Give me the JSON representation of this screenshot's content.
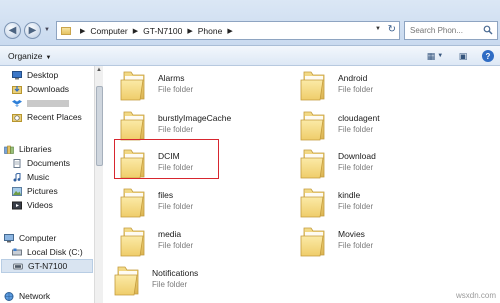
{
  "address": {
    "crumbs": [
      "Computer",
      "GT-N7100",
      "Phone"
    ]
  },
  "search": {
    "placeholder": "Search Phon..."
  },
  "toolbar": {
    "organize_label": "Organize"
  },
  "sidebar": {
    "items": [
      {
        "label": "Desktop",
        "icon": "desktop-icon"
      },
      {
        "label": "Downloads",
        "icon": "downloads-icon"
      },
      {
        "label": "",
        "icon": "dropbox-icon"
      },
      {
        "label": "Recent Places",
        "icon": "recent-places-icon"
      },
      {
        "label": "Libraries",
        "icon": "libraries-icon"
      },
      {
        "label": "Documents",
        "icon": "documents-icon"
      },
      {
        "label": "Music",
        "icon": "music-icon"
      },
      {
        "label": "Pictures",
        "icon": "pictures-icon"
      },
      {
        "label": "Videos",
        "icon": "videos-icon"
      },
      {
        "label": "Computer",
        "icon": "computer-icon"
      },
      {
        "label": "Local Disk (C:)",
        "icon": "local-disk-icon"
      },
      {
        "label": "GT-N7100",
        "icon": "phone-device-icon"
      },
      {
        "label": "Network",
        "icon": "network-icon"
      }
    ]
  },
  "folders": [
    {
      "name": "Alarms",
      "type": "File folder"
    },
    {
      "name": "Android",
      "type": "File folder"
    },
    {
      "name": "burstlyImageCache",
      "type": "File folder"
    },
    {
      "name": "cloudagent",
      "type": "File folder"
    },
    {
      "name": "DCIM",
      "type": "File folder"
    },
    {
      "name": "Download",
      "type": "File folder"
    },
    {
      "name": "files",
      "type": "File folder"
    },
    {
      "name": "kindle",
      "type": "File folder"
    },
    {
      "name": "media",
      "type": "File folder"
    },
    {
      "name": "Movies",
      "type": "File folder"
    },
    {
      "name": "Notifications",
      "type": "File folder"
    }
  ],
  "colors": {
    "highlight_border": "#d7262f",
    "folder_yellow": "#f1d77a",
    "chrome_blue": "#c9daef"
  },
  "watermark": "wsxdn.com"
}
